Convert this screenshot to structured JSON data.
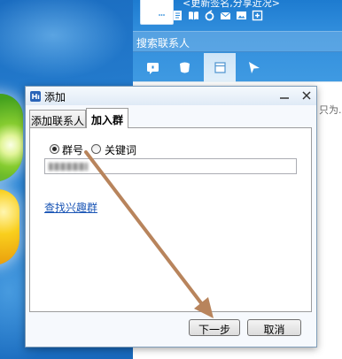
{
  "qq_panel": {
    "signature": "<更新签名,分享近况>",
    "toolbar_icons": [
      "home-icon",
      "chat-bubble-icon",
      "document-icon",
      "book-icon",
      "circle-arrow-icon",
      "mail-icon",
      "image-icon",
      "app-grid-icon"
    ],
    "search": {
      "placeholder": "搜索联系人"
    },
    "tabs": [
      {
        "icon": "chat-card-icon",
        "selected": false
      },
      {
        "icon": "bag-icon",
        "selected": false
      },
      {
        "icon": "box-icon",
        "selected": true
      },
      {
        "icon": "paper-plane-icon",
        "selected": false
      }
    ],
    "contact_snippet": "只为."
  },
  "dialog": {
    "title": "添加",
    "tabs": [
      {
        "label": "添加联系人",
        "selected": false
      },
      {
        "label": "加入群",
        "selected": true
      }
    ],
    "search_mode": {
      "options": [
        "群号",
        "关键词"
      ],
      "selected": "群号"
    },
    "find_link": "查找兴趣群",
    "buttons": {
      "next": "下一步",
      "cancel": "取消"
    }
  },
  "colors": {
    "qq_header": "#2f8cdb",
    "link": "#1a55b5",
    "annotation_arrow": "#b8845c"
  }
}
